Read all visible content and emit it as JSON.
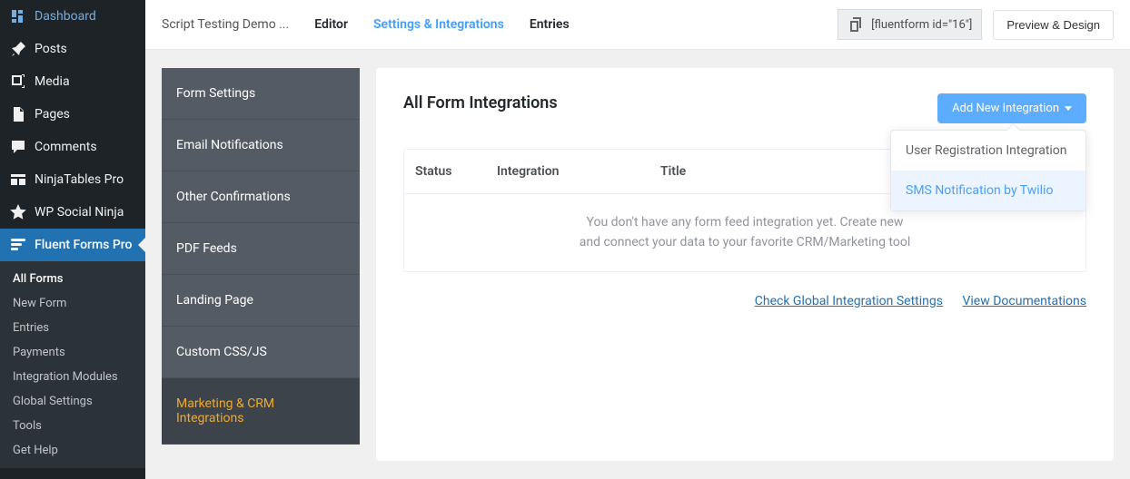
{
  "wp_sidebar": {
    "items": [
      {
        "label": "Dashboard",
        "icon": "dashboard"
      },
      {
        "label": "Posts",
        "icon": "pin"
      },
      {
        "label": "Media",
        "icon": "media"
      },
      {
        "label": "Pages",
        "icon": "pages"
      },
      {
        "label": "Comments",
        "icon": "comment"
      },
      {
        "label": "NinjaTables Pro",
        "icon": "ninjatables"
      },
      {
        "label": "WP Social Ninja",
        "icon": "star"
      },
      {
        "label": "Fluent Forms Pro",
        "icon": "fluentforms"
      }
    ],
    "submenu": [
      "All Forms",
      "New Form",
      "Entries",
      "Payments",
      "Integration Modules",
      "Global Settings",
      "Tools",
      "Get Help"
    ]
  },
  "topbar": {
    "form_title": "Script Testing Demo ...",
    "tabs": {
      "editor": "Editor",
      "settings": "Settings & Integrations",
      "entries": "Entries"
    },
    "shortcode": "[fluentform id=\"16\"]",
    "preview_label": "Preview & Design"
  },
  "settings_sidebar": [
    "Form Settings",
    "Email Notifications",
    "Other Confirmations",
    "PDF Feeds",
    "Landing Page",
    "Custom CSS/JS",
    "Marketing & CRM Integrations"
  ],
  "panel": {
    "title": "All Form Integrations",
    "add_btn_label": "Add New Integration",
    "dropdown": [
      "User Registration Integration",
      "SMS Notification by Twilio"
    ],
    "table_headers": {
      "status": "Status",
      "integration": "Integration",
      "title": "Title"
    },
    "empty_message_line1": "You don't have any form feed integration yet. Create new",
    "empty_message_line2": "and connect your data to your favorite CRM/Marketing tool",
    "links": {
      "global_settings": "Check Global Integration Settings",
      "docs": "View Documentations"
    }
  }
}
